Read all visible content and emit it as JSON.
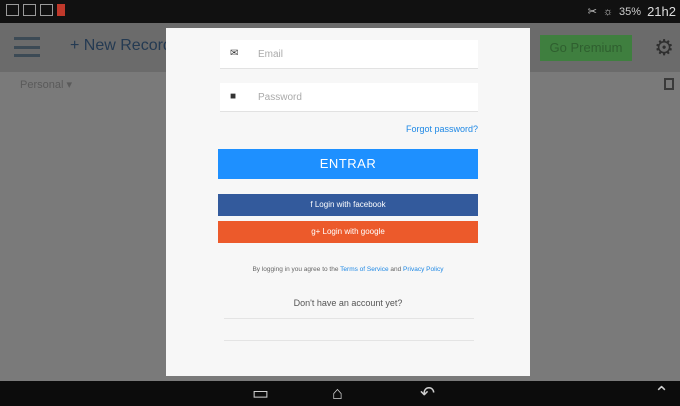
{
  "status": {
    "battery": "35%",
    "time": "21h2"
  },
  "app_bar": {
    "new_record_label": "+ New Record",
    "go_premium_label": "Go Premium"
  },
  "sub_bar": {
    "label": "Personal ▾"
  },
  "login": {
    "email_placeholder": "Email",
    "password_placeholder": "Password",
    "forgot_label": "Forgot password?",
    "entrar_label": "ENTRAR",
    "facebook_label": "f  Login with facebook",
    "google_label": "g+  Login with google",
    "terms_prefix": "By logging in you agree to the ",
    "terms_link": "Terms of Service",
    "terms_and": " and ",
    "privacy_link": "Privacy Policy",
    "no_account": "Don't have an account yet?"
  },
  "colors": {
    "primary": "#1e90ff",
    "facebook": "#335a9c",
    "google": "#ec5a2b",
    "premium": "#3f7f3f"
  },
  "icons": [
    "hamburger-icon",
    "gear-icon",
    "mail-icon",
    "lock-icon",
    "recent-apps-icon",
    "home-icon",
    "back-icon",
    "chevron-up-icon"
  ]
}
